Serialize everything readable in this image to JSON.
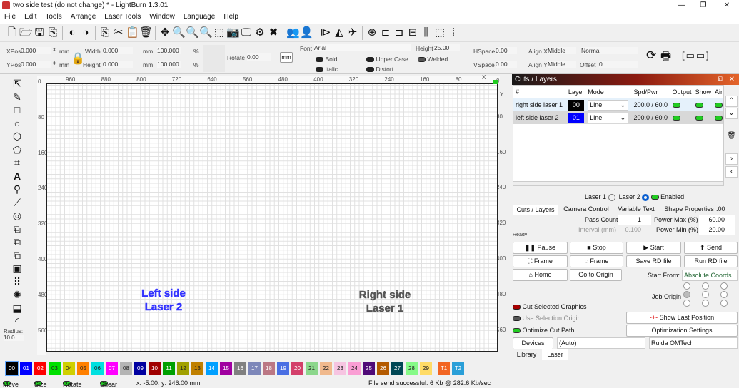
{
  "window": {
    "title": "two side test (do not change) * - LightBurn 1.3.01",
    "minimize": "—",
    "maximize": "❐",
    "close": "✕"
  },
  "menu": [
    "File",
    "Edit",
    "Tools",
    "Arrange",
    "Laser Tools",
    "Window",
    "Language",
    "Help"
  ],
  "toolbar": [
    "new-file",
    "open",
    "save",
    "import",
    "undo",
    "redo",
    "copy",
    "cut",
    "paste",
    "delete",
    "move",
    "zoom-selection",
    "zoom-in",
    "zoom-out",
    "zoom-frame",
    "camera",
    "monitor",
    "settings",
    "tools",
    "group",
    "ungroup",
    "mirror-h",
    "mirror-v",
    "send",
    "center",
    "align-left",
    "align-center",
    "dist-h",
    "dist-v",
    "dist-spacing",
    "center-lines"
  ],
  "props": {
    "xpos_label": "XPos",
    "xpos": "0.000",
    "ypos_label": "YPos",
    "ypos": "0.000",
    "unit": "mm",
    "width_label": "Width",
    "width": "0.000",
    "height_label": "Height",
    "height": "0.000",
    "scale_w": "100.000",
    "scale_h": "100.000",
    "pct": "%",
    "rotate_label": "Rotate",
    "rotate": "0.00",
    "mm_button": "mm"
  },
  "text": {
    "font_label": "Font",
    "font": "Arial",
    "height_label": "Height",
    "height": "25.00",
    "hspace_label": "HSpace",
    "hspace": "0.00",
    "vspace_label": "VSpace",
    "vspace": "0.00",
    "alignx_label": "Align X",
    "alignx": "Middle",
    "aligny_label": "Align Y",
    "aligny": "Middle",
    "style": "Normal",
    "offset_label": "Offset",
    "offset": "0",
    "bold": "Bold",
    "italic": "Italic",
    "upper": "Upper Case",
    "distort": "Distort",
    "welded": "Welded"
  },
  "ruler": {
    "top": [
      "960",
      "880",
      "800",
      "720",
      "640",
      "560",
      "480",
      "400",
      "320",
      "240",
      "160",
      "80"
    ],
    "left": [
      "0",
      "80",
      "160",
      "240",
      "320",
      "400",
      "480",
      "560"
    ],
    "x_marker": "X",
    "y_marker": "Y"
  },
  "left_tools": {
    "radius_label": "Radius:",
    "radius": "10.0"
  },
  "canvas": {
    "shapes": [
      {
        "text": "Left side\nLaser 2",
        "color": "#3333ff"
      },
      {
        "text": "Right side\nLaser 1",
        "color": "#555555"
      }
    ]
  },
  "palette": [
    {
      "l": "00",
      "c": "#000000"
    },
    {
      "l": "01",
      "c": "#0000ff"
    },
    {
      "l": "02",
      "c": "#ff0000"
    },
    {
      "l": "03",
      "c": "#00e000"
    },
    {
      "l": "04",
      "c": "#d0d000"
    },
    {
      "l": "05",
      "c": "#ff8000"
    },
    {
      "l": "06",
      "c": "#00e0e0"
    },
    {
      "l": "07",
      "c": "#ff00ff"
    },
    {
      "l": "08",
      "c": "#b4b4b4"
    },
    {
      "l": "09",
      "c": "#0000a0"
    },
    {
      "l": "10",
      "c": "#a00000"
    },
    {
      "l": "11",
      "c": "#00a000"
    },
    {
      "l": "12",
      "c": "#a0a000"
    },
    {
      "l": "13",
      "c": "#c08000"
    },
    {
      "l": "14",
      "c": "#00a0ff"
    },
    {
      "l": "15",
      "c": "#a000a0"
    },
    {
      "l": "16",
      "c": "#808080"
    },
    {
      "l": "17",
      "c": "#7d87b9"
    },
    {
      "l": "18",
      "c": "#bb7784"
    },
    {
      "l": "19",
      "c": "#4a6fe3"
    },
    {
      "l": "20",
      "c": "#d33f6a"
    },
    {
      "l": "21",
      "c": "#8cd78c"
    },
    {
      "l": "22",
      "c": "#f0b98d"
    },
    {
      "l": "23",
      "c": "#f6c4e1"
    },
    {
      "l": "24",
      "c": "#fa9ed4"
    },
    {
      "l": "25",
      "c": "#500a78"
    },
    {
      "l": "26",
      "c": "#b45a00"
    },
    {
      "l": "27",
      "c": "#004754"
    },
    {
      "l": "28",
      "c": "#86fa88"
    },
    {
      "l": "29",
      "c": "#ffdb66"
    },
    {
      "l": "T1",
      "c": "#f26522"
    },
    {
      "l": "T2",
      "c": "#2a9fd8"
    }
  ],
  "status": {
    "move": "Move",
    "size": "Size",
    "rotate": "Rotate",
    "shear": "Shear",
    "coords": "x: -5.00, y: 246.00 mm",
    "message": "File send successful: 6 Kb @ 282.6 Kb/sec"
  },
  "cuts": {
    "title": "Cuts / Layers",
    "headers": [
      "#",
      "Layer",
      "Mode",
      "Spd/Pwr",
      "Output",
      "Show",
      "Air"
    ],
    "rows": [
      {
        "name": "right side laser 1",
        "layer": "00",
        "color": "#000000",
        "mode": "Line",
        "spdpwr": "200.0 / 60.0"
      },
      {
        "name": "left side laser 2",
        "layer": "01",
        "color": "#0000ff",
        "mode": "Line",
        "spdpwr": "200.0 / 60.0"
      }
    ]
  },
  "laser_select": {
    "laser1": "Laser 1",
    "laser2": "Laser 2",
    "enabled": "Enabled"
  },
  "tabs": [
    "Cuts / Layers",
    "Camera Control",
    "Variable Text",
    "Shape Properties"
  ],
  "tab_fields": {
    "pass_count_label": "Pass Count",
    "pass_count": "1",
    "interval_label": "Interval (mm)",
    "interval": "0.100",
    "pmax_label": "Power Max (%)",
    "pmax": "60.00",
    "pmin_label": "Power Min (%)",
    "pmin": "20.00",
    "extra": ".00",
    "ready": "Ready"
  },
  "laser": {
    "pause": "Pause",
    "stop": "Stop",
    "start": "Start",
    "send": "Send",
    "frame1": "Frame",
    "frame2": "Frame",
    "save_rd": "Save RD file",
    "run_rd": "Run RD file",
    "home": "Home",
    "go_origin": "Go to Origin",
    "start_from_label": "Start From:",
    "start_from": "Absolute Coords",
    "job_origin": "Job Origin",
    "cut_selected": "Cut Selected Graphics",
    "use_sel_origin": "Use Selection Origin",
    "optimize": "Optimize Cut Path",
    "show_last": "Show Last Position",
    "opt_settings": "Optimization Settings",
    "devices": "Devices",
    "port": "(Auto)",
    "device": "Ruida OMTech"
  },
  "bottom_tabs": [
    "Library",
    "Laser"
  ]
}
